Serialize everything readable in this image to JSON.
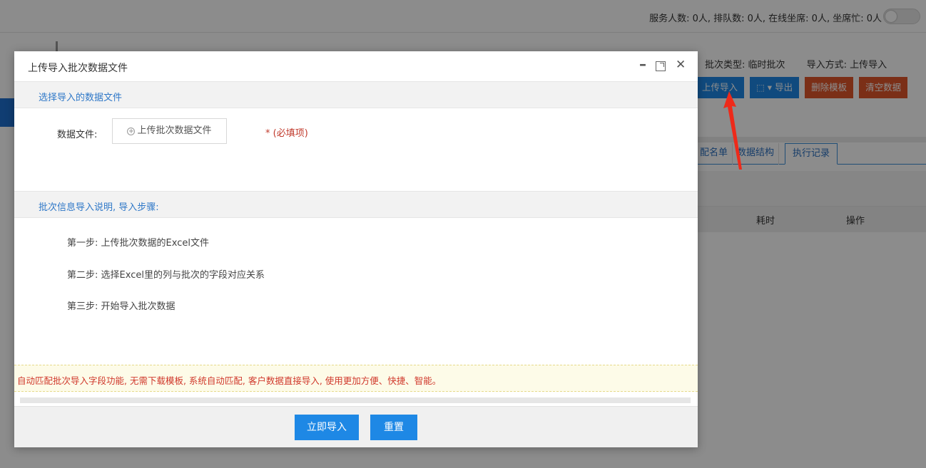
{
  "topbar": {
    "stats": "服务人数: 0人, 排队数: 0人, 在线坐席: 0人, 坐席忙: 0人"
  },
  "background": {
    "batch_type": "批次类型: 临时批次",
    "import_mode": "导入方式: 上传导入",
    "buttons": {
      "upload_import": "上传导入",
      "export": "导出",
      "delete_template": "删除模板",
      "clear_data": "清空数据"
    },
    "tabs": [
      "配名单",
      "数据结构",
      "执行记录"
    ],
    "active_tab": "执行记录",
    "table_headers": {
      "duration": "耗时",
      "operation": "操作"
    }
  },
  "modal": {
    "title": "上传导入批次数据文件",
    "section1_title": "选择导入的数据文件",
    "field_label": "数据文件:",
    "upload_button": "上传批次数据文件",
    "required_hint": "* (必填项)",
    "section2_title": "批次信息导入说明, 导入步骤:",
    "steps": [
      "第一步: 上传批次数据的Excel文件",
      "第二步: 选择Excel里的列与批次的字段对应关系",
      "第三步: 开始导入批次数据"
    ],
    "notice": "自动匹配批次导入字段功能, 无需下载模板, 系统自动匹配, 客户数据直接导入, 使用更加方便、快捷、智能。",
    "import_button": "立即导入",
    "reset_button": "重置"
  },
  "colors": {
    "primary": "#1e88e5",
    "danger": "#e0562b",
    "section_title": "#2f78c8",
    "notice_text": "#d0382b",
    "annotation_arrow": "#ee2a1a"
  }
}
